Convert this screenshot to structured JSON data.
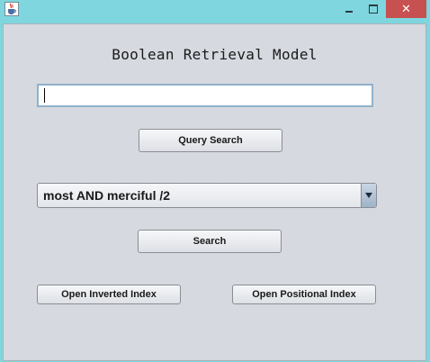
{
  "window": {
    "icon": "java-cup-icon",
    "minimize_icon": "minimize-icon",
    "maximize_icon": "maximize-icon",
    "close_glyph": "✕"
  },
  "main": {
    "title": "Boolean Retrieval Model",
    "query_input": {
      "value": "",
      "placeholder": ""
    },
    "query_search_label": "Query Search",
    "query_select": {
      "selected": "most AND merciful /2",
      "options": [
        "most AND merciful /2"
      ]
    },
    "search_label": "Search",
    "open_inverted_label": "Open Inverted Index",
    "open_positional_label": "Open Positional Index"
  }
}
